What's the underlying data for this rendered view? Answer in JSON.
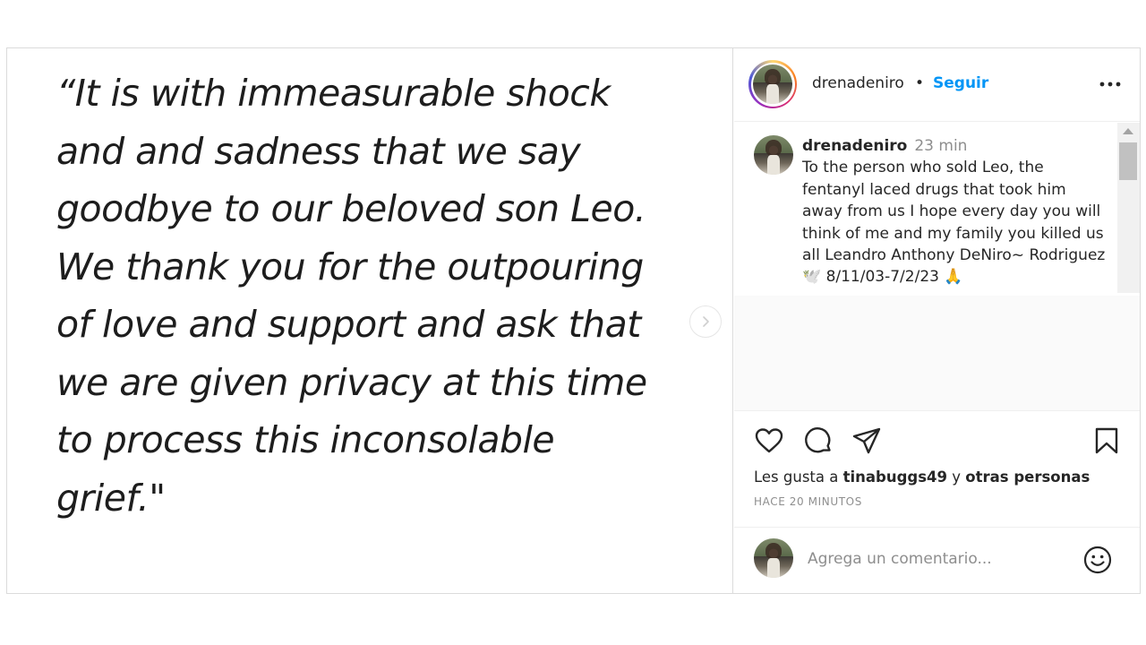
{
  "media": {
    "quote": "“It is with immeasurable shock\nand and sadness that we say\ngoodbye to our beloved son Leo.\nWe thank you for the outpouring\nof love and support and ask that\nwe are given privacy at this time\nto process this inconsolable\ngrief.\"",
    "next_icon": "chevron-right-icon"
  },
  "header": {
    "username": "drenadeniro",
    "separator": "•",
    "follow_label": "Seguir",
    "more_icon": "ellipsis-icon"
  },
  "caption": {
    "username": "drenadeniro",
    "time": "23 min",
    "text": "To the person who sold Leo, the fentanyl laced drugs that took him away from us I hope every day you will think of me and my family you killed us all Leandro Anthony DeNiro~ Rodriguez 🕊️ 8/11/03-7/2/23 🙏"
  },
  "actions": {
    "icons": [
      "heart-icon",
      "comment-icon",
      "share-icon",
      "bookmark-icon"
    ]
  },
  "likes": {
    "prefix": "Les gusta a",
    "user": "tinabuggs49",
    "connector": "y",
    "others": "otras personas"
  },
  "post_time": "HACE 20 MINUTOS",
  "comment_box": {
    "placeholder": "Agrega un comentario...",
    "emoji_icon": "smiley-icon"
  },
  "colors": {
    "link_blue": "#0095f6",
    "border": "#dbdbdb",
    "muted": "#8e8e8e"
  }
}
